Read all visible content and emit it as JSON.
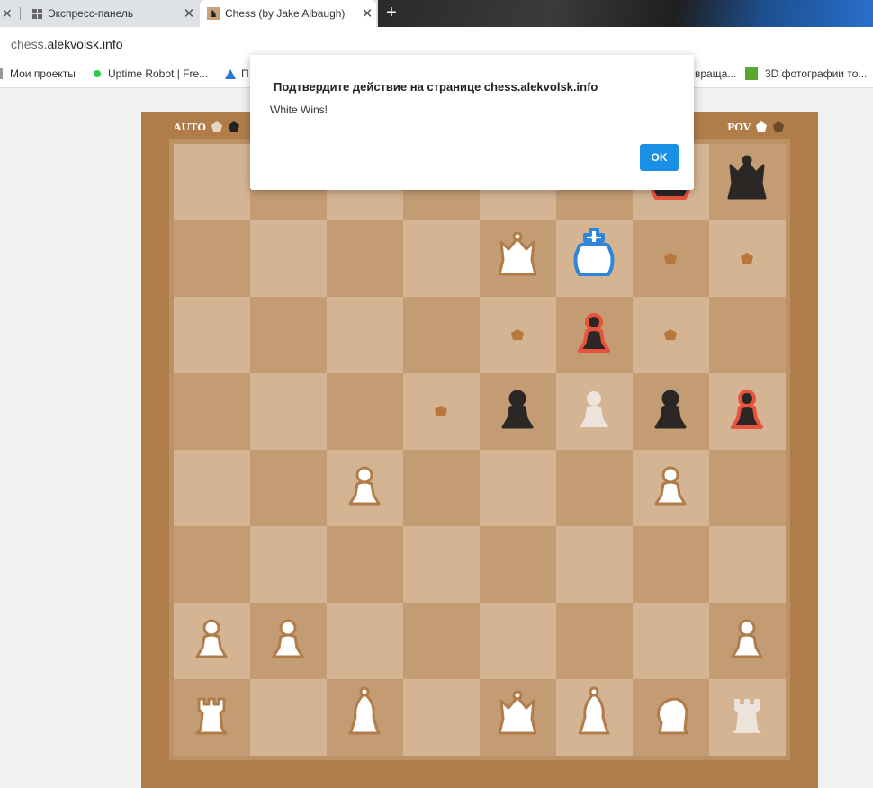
{
  "browser": {
    "tabs": [
      {
        "title": "Экспресс-панель"
      },
      {
        "title": "Chess (by Jake Albaugh)"
      }
    ],
    "url_host": "chess.",
    "url_domain": "alekvolsk.info",
    "bookmarks": [
      {
        "label": "Мои проекты"
      },
      {
        "label": "Uptime Robot | Fre..."
      },
      {
        "label": "П"
      },
      {
        "label": "враща..."
      },
      {
        "label": "3D фотографии то..."
      }
    ]
  },
  "hud": {
    "auto_label": "AUTO",
    "pov_label": "POV"
  },
  "dialog": {
    "title": "Подтвердите действие на странице chess.alekvolsk.info",
    "message": "White Wins!",
    "ok_label": "OK"
  },
  "colors": {
    "board_frame": "#b07d4a",
    "light_square": "#d4b492",
    "dark_square": "#c49c74",
    "white_piece": "#ffffff",
    "black_piece": "#2b2724",
    "selected_outline": "#2f86d8",
    "threat_outline": "#e9523c",
    "move_hint": "#b8773d",
    "ok_button": "#1a8fe6"
  },
  "board": {
    "rows": [
      [
        "",
        "",
        "",
        "",
        "",
        "",
        "bk-threat",
        "bq"
      ],
      [
        "",
        "",
        "",
        "",
        "wq",
        "wk-selected",
        "hint",
        "hint"
      ],
      [
        "",
        "",
        "",
        "",
        "hint",
        "bp-threat",
        "hint",
        ""
      ],
      [
        "",
        "",
        "",
        "hint",
        "bp",
        "wp-faded",
        "bp",
        "bp-threat"
      ],
      [
        "",
        "",
        "wp",
        "",
        "",
        "",
        "wp",
        ""
      ],
      [
        "",
        "",
        "",
        "",
        "",
        "",
        "",
        ""
      ],
      [
        "wp",
        "wp",
        "",
        "",
        "",
        "",
        "",
        "wp"
      ],
      [
        "wr",
        "",
        "wb",
        "",
        "wq",
        "wb",
        "wn",
        "wr-faded"
      ]
    ]
  }
}
